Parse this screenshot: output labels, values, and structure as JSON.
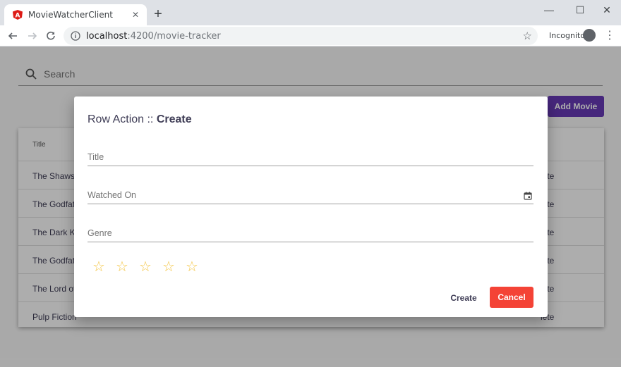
{
  "browser": {
    "tab_title": "MovieWatcherClient",
    "url_host": "localhost",
    "url_path": ":4200/movie-tracker",
    "incognito_label": "Incognito"
  },
  "app": {
    "search_placeholder": "Search",
    "add_button": "Add Movie",
    "table": {
      "column_title": "Title",
      "rows": [
        {
          "title": "The Shawst",
          "action": "lete"
        },
        {
          "title": "The Godfat",
          "action": "lete"
        },
        {
          "title": "The Dark Kr",
          "action": "lete"
        },
        {
          "title": "The Godfat",
          "action": "lete"
        },
        {
          "title": "The Lord of",
          "action": "lete"
        },
        {
          "title": "Pulp Fiction",
          "action": "lete"
        }
      ]
    }
  },
  "dialog": {
    "title_prefix": "Row Action :: ",
    "title_action": "Create",
    "fields": {
      "title": "Title",
      "watched_on": "Watched On",
      "genre": "Genre"
    },
    "rating_stars": 5,
    "create_button": "Create",
    "cancel_button": "Cancel"
  },
  "colors": {
    "accent": "#673ab7",
    "cancel": "#f44336",
    "star": "#f4c542",
    "title_text": "#3f3d56"
  }
}
